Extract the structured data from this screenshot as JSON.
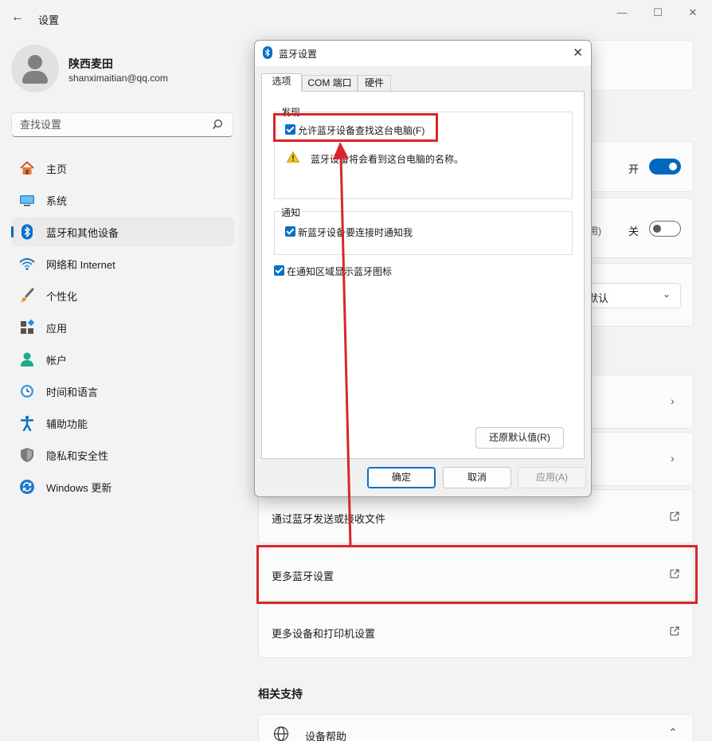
{
  "app": {
    "title": "设置",
    "back_icon": "back-arrow-icon",
    "window_controls": [
      "minimize-icon",
      "maximize-icon",
      "close-icon"
    ]
  },
  "profile": {
    "name": "陕西麦田",
    "email": "shanximaitian@qq.com"
  },
  "search": {
    "placeholder": "查找设置",
    "icon": "search-icon"
  },
  "sidebar": {
    "items": [
      {
        "label": "主页",
        "icon": "home-icon"
      },
      {
        "label": "系统",
        "icon": "system-icon"
      },
      {
        "label": "蓝牙和其他设备",
        "icon": "bluetooth-icon",
        "active": true
      },
      {
        "label": "网络和 Internet",
        "icon": "wifi-icon"
      },
      {
        "label": "个性化",
        "icon": "brush-icon"
      },
      {
        "label": "应用",
        "icon": "apps-icon"
      },
      {
        "label": "帐户",
        "icon": "account-icon"
      },
      {
        "label": "时间和语言",
        "icon": "clock-globe-icon"
      },
      {
        "label": "辅助功能",
        "icon": "accessibility-icon"
      },
      {
        "label": "隐私和安全性",
        "icon": "shield-icon"
      },
      {
        "label": "Windows 更新",
        "icon": "update-icon"
      }
    ]
  },
  "main": {
    "bluetooth_toggle_label": "开",
    "second_toggle_label": "关",
    "second_toggle_hint": "用)",
    "dropdown_value": "默认",
    "links": {
      "send_receive": "通过蓝牙发送或接收文件",
      "more_bluetooth": "更多蓝牙设置",
      "more_devices": "更多设备和打印机设置"
    },
    "related_support_heading": "相关支持",
    "device_help": "设备帮助"
  },
  "dialog": {
    "title": "蓝牙设置",
    "tabs": [
      "选项",
      "COM 端口",
      "硬件"
    ],
    "discovery_group": "发现",
    "allow_discovery": "允许蓝牙设备查找这台电脑(F)",
    "warning_text": "蓝牙设备将会看到这台电脑的名称。",
    "notify_group": "通知",
    "notify_new_device": "新蓝牙设备要连接时通知我",
    "show_tray_icon": "在通知区域显示蓝牙图标",
    "restore_defaults": "还原默认值(R)",
    "ok": "确定",
    "cancel": "取消",
    "apply": "应用(A)"
  },
  "colors": {
    "accent": "#0067c0",
    "highlight_red": "#d8262c"
  }
}
